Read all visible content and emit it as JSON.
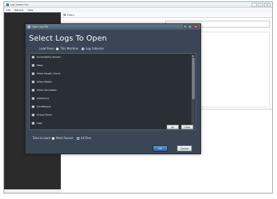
{
  "app": {
    "title": "Log Viewer Pro",
    "menu": [
      "File",
      "Refresh",
      "Help"
    ],
    "filter_label": "Filters",
    "window_controls": [
      "–",
      "□",
      "✕"
    ]
  },
  "dialog": {
    "title": "Open Log File",
    "heading": "Select Logs To Open",
    "load_from_label": "Load From:",
    "load_from_options": [
      {
        "label": "This Machine",
        "selected": false
      },
      {
        "label": "Log Collector",
        "selected": true
      }
    ],
    "items": [
      {
        "label": "Accessibility Builder"
      },
      {
        "label": "Maps"
      },
      {
        "label": "Video Health Check"
      },
      {
        "label": "Video Mobile"
      },
      {
        "label": "Video Simulation"
      },
      {
        "label": "VideoCore"
      },
      {
        "label": "ZoneReport"
      },
      {
        "label": "Virtual Panel"
      },
      {
        "label": "Logs"
      }
    ],
    "buttons": {
      "all": "All",
      "clear": "Clear",
      "ok": "OK",
      "cancel": "Cancel"
    },
    "time_label": "Time to load:",
    "time_options": [
      {
        "label": "Most Recent",
        "selected": false
      },
      {
        "label": "All Files",
        "selected": true
      }
    ],
    "controls": [
      "–",
      "□",
      "✕"
    ]
  },
  "colors": {
    "dialog_bg": "#3a4655",
    "list_bg": "#2a2f36",
    "ok_blue": "#2f6bb1",
    "left_panel": "#2b2b2b"
  }
}
